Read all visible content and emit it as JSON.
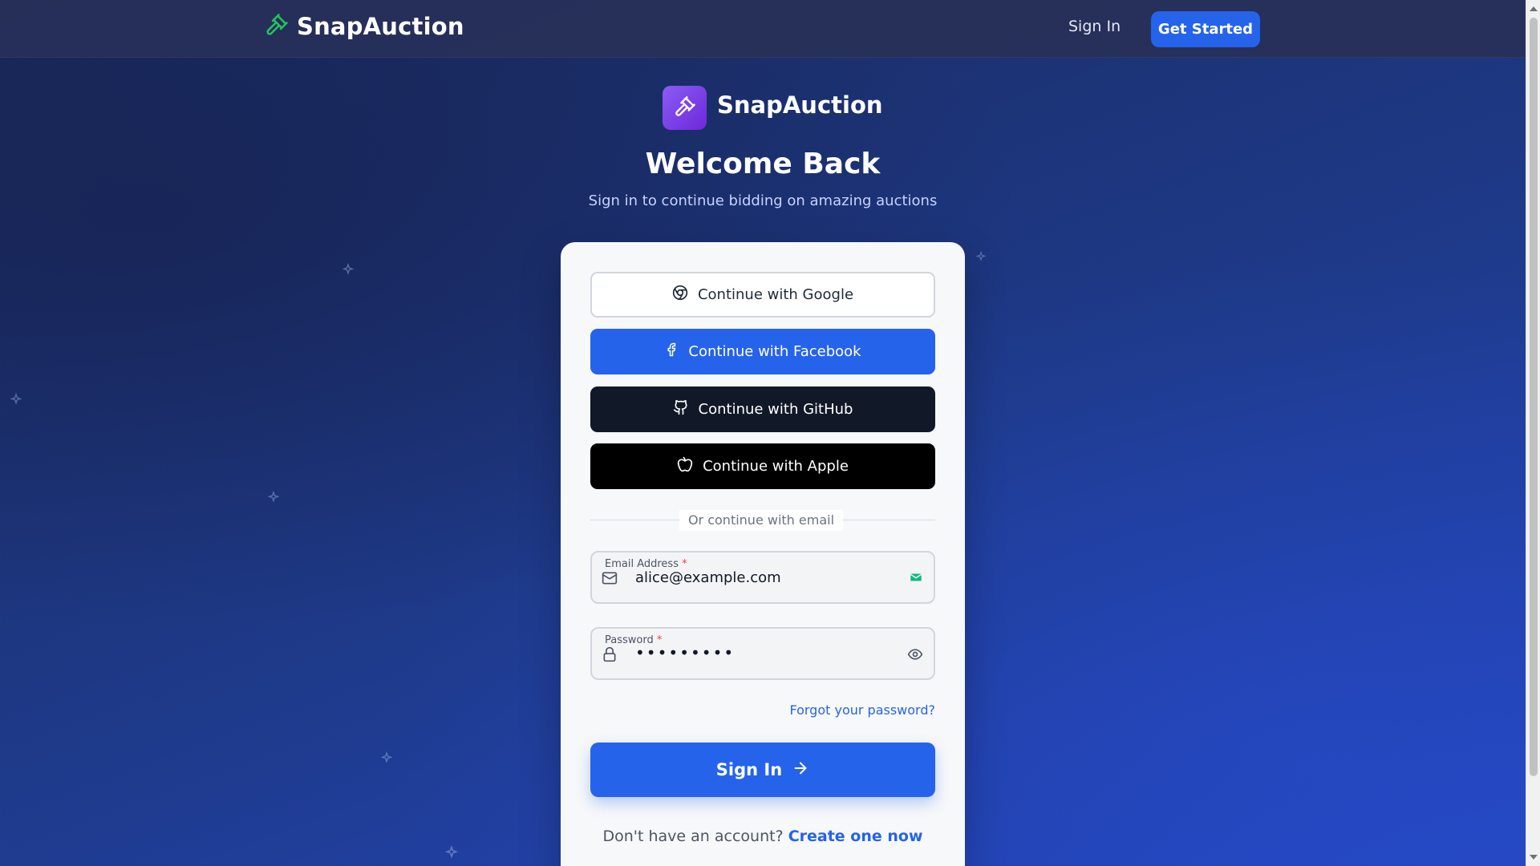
{
  "navbar": {
    "brand": "SnapAuction",
    "signin_label": "Sign In",
    "cta_label": "Get Started"
  },
  "header": {
    "brand": "SnapAuction",
    "title": "Welcome Back",
    "subtitle": "Sign in to continue bidding on amazing auctions"
  },
  "sso": {
    "google": "Continue with Google",
    "facebook": "Continue with Facebook",
    "github": "Continue with GitHub",
    "apple": "Continue with Apple"
  },
  "divider": "Or continue with email",
  "email": {
    "label": "Email Address",
    "required": "*",
    "value": "alice@example.com"
  },
  "password": {
    "label": "Password",
    "required": "*",
    "value": "•••••••••"
  },
  "forgot_label": "Forgot your password?",
  "submit_label": "Sign In",
  "signup": {
    "prompt": "Don't have an account?",
    "link": "Create one now"
  },
  "colors": {
    "accent": "#2563eb",
    "brand_green": "#22c55e",
    "logo_purple": "#8b5cf6"
  },
  "icons": [
    "gavel-icon",
    "chrome-icon",
    "facebook-icon",
    "github-icon",
    "apple-icon",
    "mail-icon",
    "lock-icon",
    "eye-icon",
    "arrow-right-icon",
    "sparkle-icon"
  ]
}
